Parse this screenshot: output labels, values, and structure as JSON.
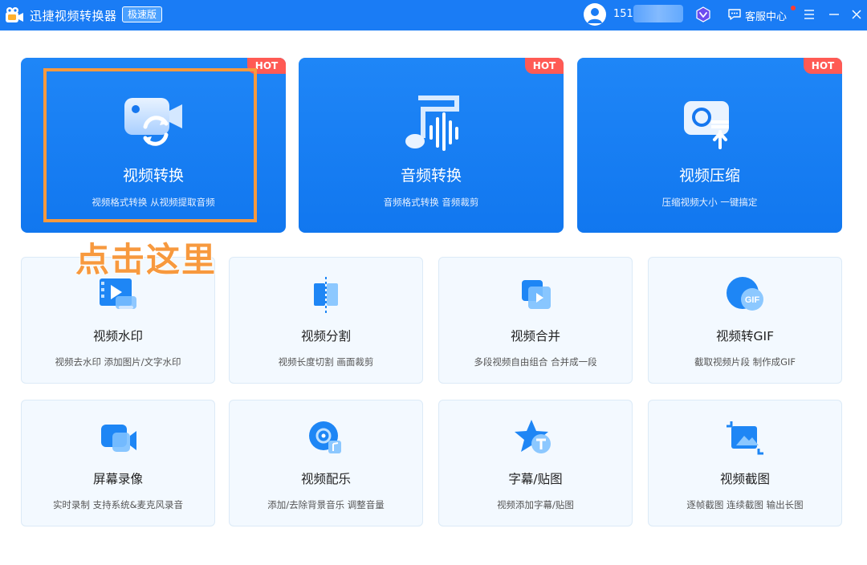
{
  "app": {
    "title": "迅捷视频转换器",
    "edition": "极速版"
  },
  "header": {
    "username_visible": "151",
    "service_label": "客服中心"
  },
  "colors": {
    "titlebar": "#1a7cf5",
    "big_card": "#1177ef",
    "hot_badge": "#ff5a54",
    "tool_card_bg": "#f3f9ff",
    "annotation": "#f7993e"
  },
  "feature_cards": [
    {
      "title": "视频转换",
      "desc": "视频格式转换 从视频提取音频",
      "badge": "HOT",
      "icon": "video-convert-icon"
    },
    {
      "title": "音频转换",
      "desc": "音频格式转换 音频裁剪",
      "badge": "HOT",
      "icon": "audio-convert-icon"
    },
    {
      "title": "视频压缩",
      "desc": "压缩视频大小 一键搞定",
      "badge": "HOT",
      "icon": "video-compress-icon"
    }
  ],
  "tools": [
    {
      "title": "视频水印",
      "desc": "视频去水印 添加图片/文字水印",
      "icon": "watermark-icon"
    },
    {
      "title": "视频分割",
      "desc": "视频长度切割 画面裁剪",
      "icon": "split-icon"
    },
    {
      "title": "视频合并",
      "desc": "多段视频自由组合 合并成一段",
      "icon": "merge-icon"
    },
    {
      "title": "视频转GIF",
      "desc": "截取视频片段 制作成GIF",
      "icon": "gif-icon"
    },
    {
      "title": "屏幕录像",
      "desc": "实时录制 支持系统&麦克风录音",
      "icon": "screen-record-icon"
    },
    {
      "title": "视频配乐",
      "desc": "添加/去除背景音乐 调整音量",
      "icon": "music-icon"
    },
    {
      "title": "字幕/贴图",
      "desc": "视频添加字幕/贴图",
      "icon": "subtitle-icon"
    },
    {
      "title": "视频截图",
      "desc": "逐帧截图 连续截图 输出长图",
      "icon": "screenshot-icon"
    }
  ],
  "annotation": {
    "callout": "点击这里"
  }
}
